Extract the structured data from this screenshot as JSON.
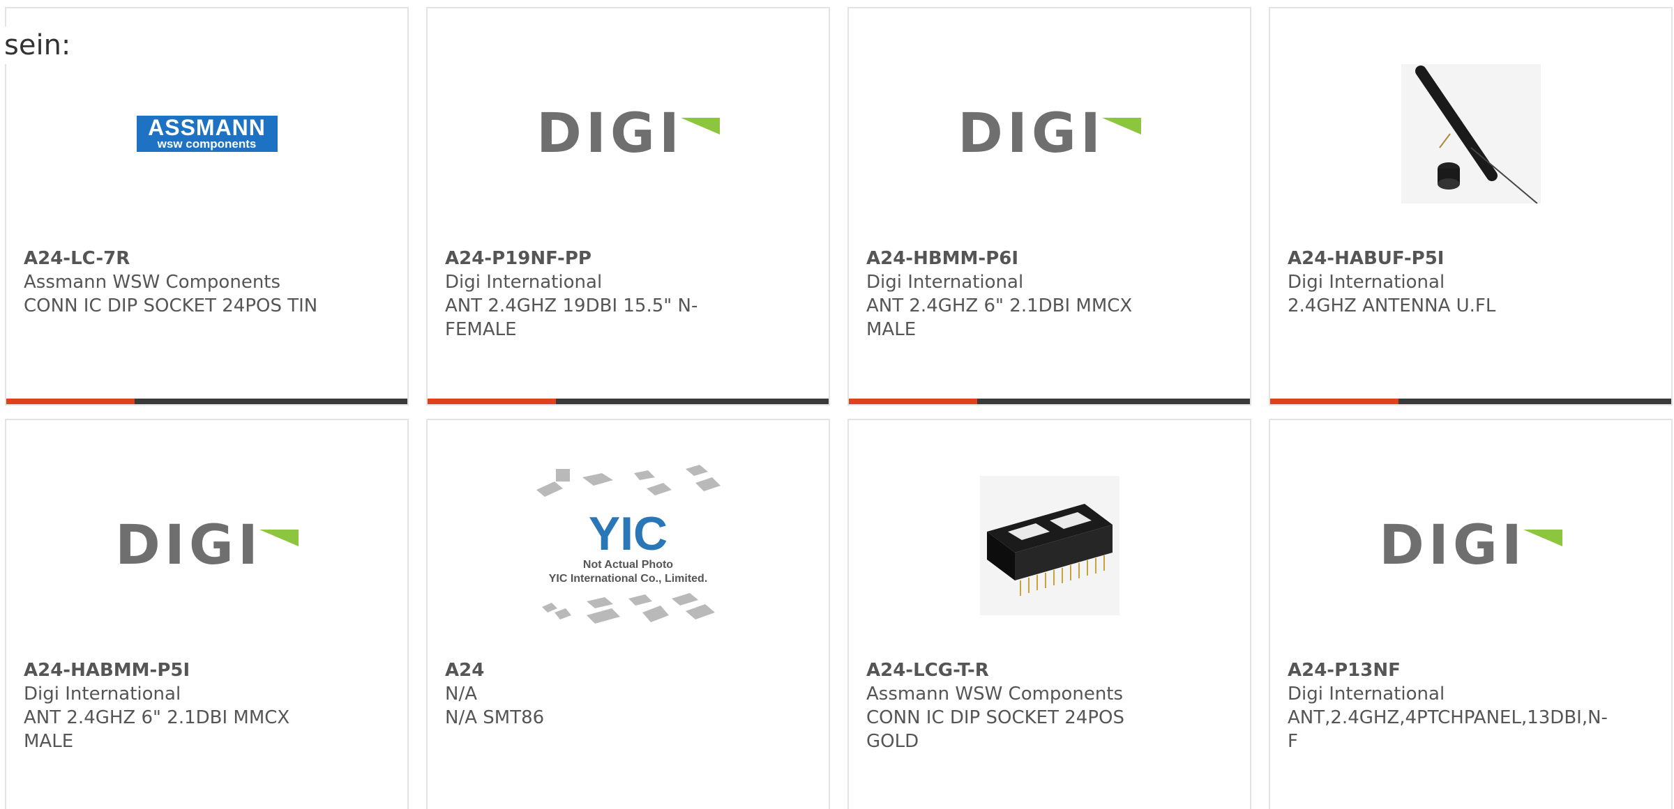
{
  "intro_text": "sein:",
  "cards": [
    {
      "part": "A24-LC-7R",
      "maker": "Assmann WSW Components",
      "desc_1": "CONN IC DIP SOCKET 24POS TIN",
      "desc_2": "",
      "logo": "assmann-logo",
      "logo_text_1": "ASSMANN",
      "logo_text_2": "wsw components"
    },
    {
      "part": "A24-P19NF-PP",
      "maker": "Digi International",
      "desc_1": "ANT 2.4GHZ 19DBI 15.5\" N-",
      "desc_2": "FEMALE",
      "logo": "digi-logo",
      "logo_text": "DIGI"
    },
    {
      "part": "A24-HBMM-P6I",
      "maker": "Digi International",
      "desc_1": "ANT 2.4GHZ 6\" 2.1DBI MMCX",
      "desc_2": "MALE",
      "logo": "digi-logo",
      "logo_text": "DIGI"
    },
    {
      "part": "A24-HABUF-P5I",
      "maker": "Digi International",
      "desc_1": "2.4GHZ ANTENNA U.FL",
      "desc_2": "",
      "logo": "antenna-photo"
    },
    {
      "part": "A24-HABMM-P5I",
      "maker": "Digi International",
      "desc_1": "ANT 2.4GHZ 6\" 2.1DBI MMCX",
      "desc_2": "MALE",
      "logo": "digi-logo",
      "logo_text": "DIGI"
    },
    {
      "part": "A24",
      "maker": "N/A",
      "desc_1": "N/A SMT86",
      "desc_2": "",
      "logo": "yic-placeholder",
      "logo_text": "YIC",
      "caption_1": "Not Actual Photo",
      "caption_2": "YIC International Co., Limited."
    },
    {
      "part": "A24-LCG-T-R",
      "maker": "Assmann WSW Components",
      "desc_1": "CONN IC DIP SOCKET 24POS",
      "desc_2": "GOLD",
      "logo": "dip-socket-photo"
    },
    {
      "part": "A24-P13NF",
      "maker": "Digi International",
      "desc_1": "ANT,2.4GHZ,4PTCHPANEL,13DBI,N-",
      "desc_2": "F",
      "logo": "digi-logo",
      "logo_text": "DIGI"
    }
  ],
  "colors": {
    "accent": "#e0401c",
    "bar": "#3a3a3a",
    "digi_green": "#8cc63f",
    "assmann_blue": "#1d72c4"
  }
}
